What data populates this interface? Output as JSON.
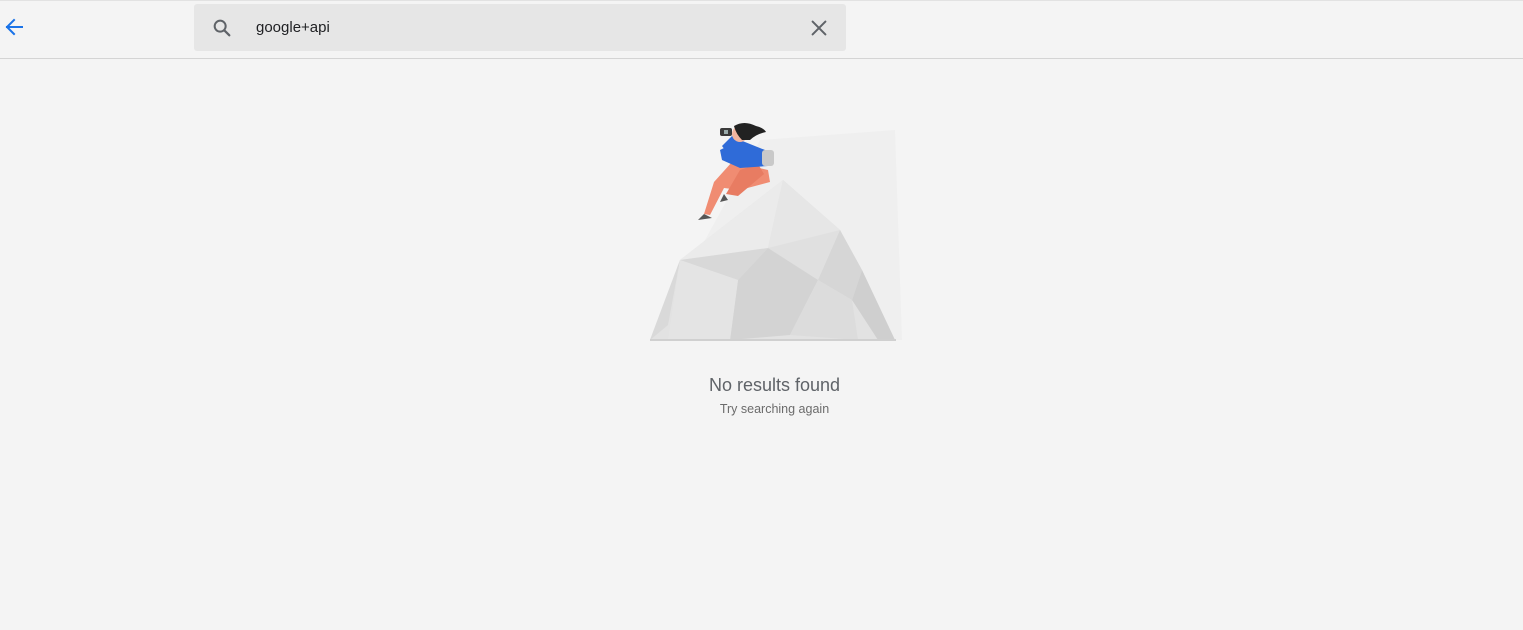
{
  "search": {
    "value": "google+api",
    "placeholder": ""
  },
  "icons": {
    "back": "arrow-back-icon",
    "search": "search-icon",
    "clear": "close-icon"
  },
  "empty_state": {
    "title": "No results found",
    "subtitle": "Try searching again"
  },
  "colors": {
    "accent": "#1a73e8",
    "background": "#f4f4f4",
    "search_bg": "#e6e6e6"
  }
}
